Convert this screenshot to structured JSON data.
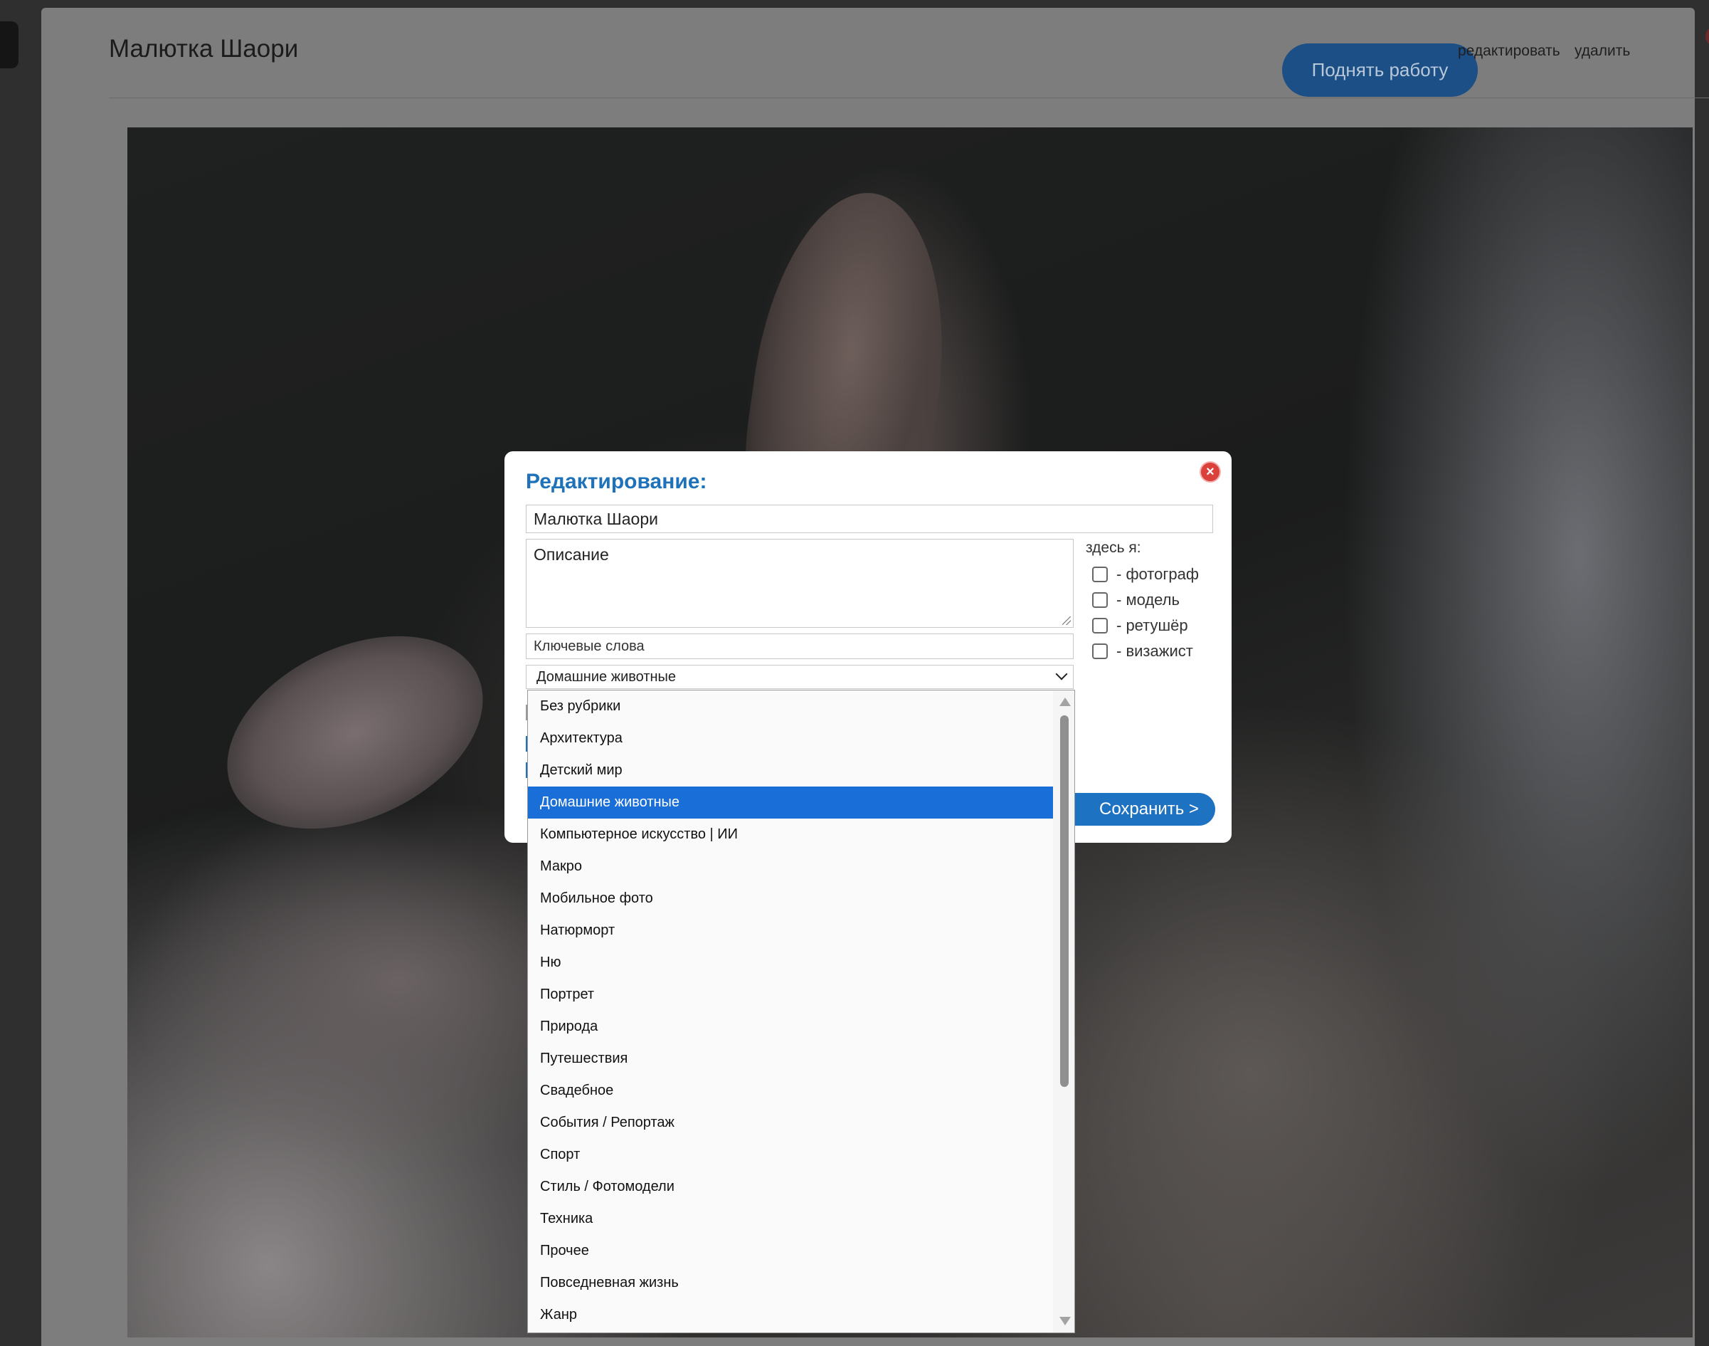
{
  "window": {
    "title": "Малютка Шаори",
    "raise_button": "Поднять работу",
    "edit_link": "редактировать",
    "delete_link": "удалить"
  },
  "modal": {
    "heading": "Редактирование:",
    "title_value": "Малютка Шаори",
    "description_placeholder": "Описание",
    "keywords_placeholder": "Ключевые слова",
    "category_selected": "Домашние животные",
    "roles_heading": "здесь я:",
    "roles": [
      {
        "label": "- фотограф",
        "checked": false
      },
      {
        "label": "- модель",
        "checked": false
      },
      {
        "label": "- ретушёр",
        "checked": false
      },
      {
        "label": "- визажист",
        "checked": false
      }
    ],
    "save_button": "Сохранить >"
  },
  "category_options": [
    "Без рубрики",
    "Архитектура",
    "Детский мир",
    "Домашние животные",
    "Компьютерное искусство | ИИ",
    "Макро",
    "Мобильное фото",
    "Натюрморт",
    "Ню",
    "Портрет",
    "Природа",
    "Путешествия",
    "Свадебное",
    "События / Репортаж",
    "Спорт",
    "Стиль / Фотомодели",
    "Техника",
    "Прочее",
    "Повседневная жизнь",
    "Жанр"
  ],
  "selected_option_index": 3,
  "colors": {
    "accent": "#1e72c2",
    "selection": "#1a6ed8",
    "heading": "#1e72b9",
    "close": "#d9413a"
  }
}
